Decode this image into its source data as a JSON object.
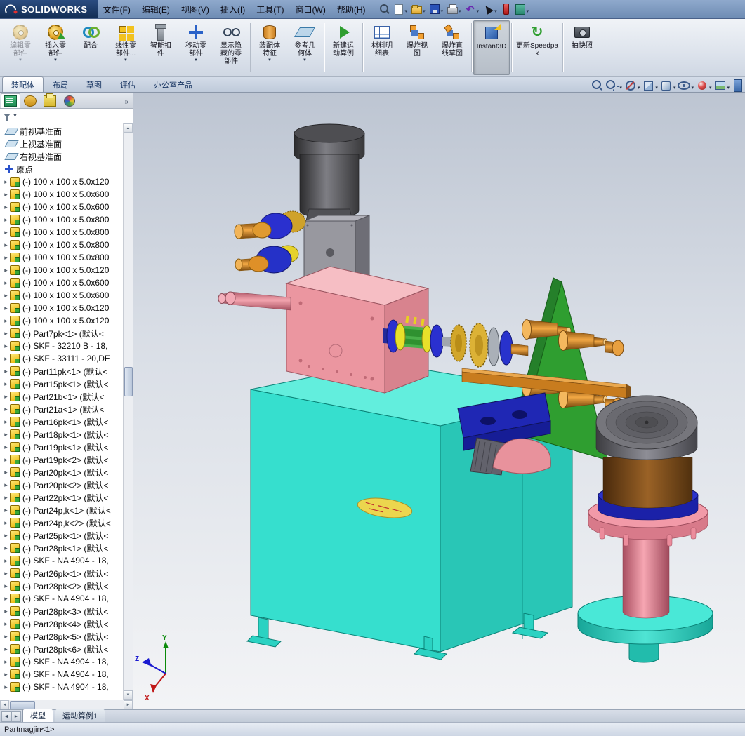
{
  "app": {
    "brand": "SOLIDWORKS",
    "menus": [
      "文件(F)",
      "编辑(E)",
      "视图(V)",
      "插入(I)",
      "工具(T)",
      "窗口(W)",
      "帮助(H)"
    ],
    "quick_access": [
      {
        "id": "search"
      },
      {
        "id": "new-document",
        "caret": true
      },
      {
        "id": "open",
        "caret": true
      },
      {
        "id": "save",
        "caret": true
      },
      {
        "id": "print",
        "caret": true
      },
      {
        "id": "undo",
        "caret": true
      },
      {
        "id": "select",
        "caret": true
      },
      {
        "id": "rebuild"
      },
      {
        "id": "options",
        "caret": true
      }
    ]
  },
  "ribbon": {
    "buttons": [
      {
        "id": "edit-component",
        "label": "编辑零部件",
        "dropdown": true,
        "disabled": true
      },
      {
        "id": "insert-component",
        "label": "插入零部件",
        "dropdown": true
      },
      {
        "id": "mate",
        "label": "配合"
      },
      {
        "id": "linear-pattern",
        "label": "线性零部件...",
        "dropdown": true
      },
      {
        "id": "smart-fasteners",
        "label": "智能扣件"
      },
      {
        "id": "move-component",
        "label": "移动零部件",
        "dropdown": true
      },
      {
        "id": "show-hidden-components",
        "label": "显示隐藏的零部件"
      },
      {
        "id": "assembly-features",
        "label": "装配体特征",
        "dropdown": true
      },
      {
        "id": "reference-geometry",
        "label": "参考几何体",
        "dropdown": true
      },
      {
        "id": "new-motion-study",
        "label": "新建运动算例"
      },
      {
        "id": "bill-of-materials",
        "label": "材料明细表"
      },
      {
        "id": "exploded-view",
        "label": "爆炸视图"
      },
      {
        "id": "explode-line-sketch",
        "label": "爆炸直线草图"
      },
      {
        "id": "instant3d",
        "label": "Instant3D",
        "active": true
      },
      {
        "id": "update-speedpak",
        "label": "更新Speedpak"
      },
      {
        "id": "take-snapshot",
        "label": "拍快照"
      }
    ]
  },
  "command_tabs": {
    "tabs": [
      {
        "id": "assembly",
        "label": "装配体",
        "active": true
      },
      {
        "id": "layout",
        "label": "布局"
      },
      {
        "id": "sketch",
        "label": "草图"
      },
      {
        "id": "evaluate",
        "label": "评估"
      },
      {
        "id": "office-products",
        "label": "办公室产品"
      }
    ]
  },
  "view_toolbar": {
    "icons": [
      {
        "id": "zoom-to-fit"
      },
      {
        "id": "zoom-to-area",
        "caret": true
      },
      {
        "id": "section-view",
        "caret": true
      },
      {
        "id": "view-orientation",
        "caret": true
      },
      {
        "id": "display-style",
        "caret": true
      },
      {
        "id": "hide-show-items",
        "caret": true
      },
      {
        "id": "edit-appearance",
        "caret": true
      },
      {
        "id": "apply-scene",
        "caret": true
      }
    ]
  },
  "panel": {
    "tabs": [
      {
        "id": "feature-manager",
        "active": true
      },
      {
        "id": "property-manager"
      },
      {
        "id": "configuration-manager"
      },
      {
        "id": "display-manager"
      }
    ],
    "overflow": "»",
    "tree": [
      {
        "icon": "plane",
        "label": "前视基准面"
      },
      {
        "icon": "plane",
        "label": "上视基准面"
      },
      {
        "icon": "plane",
        "label": "右视基准面"
      },
      {
        "icon": "origin",
        "label": "原点"
      },
      {
        "icon": "part",
        "label": "(-) 100 x 100 x 5.0x120"
      },
      {
        "icon": "part",
        "label": "(-) 100 x 100 x 5.0x600"
      },
      {
        "icon": "part",
        "label": "(-) 100 x 100 x 5.0x600"
      },
      {
        "icon": "part",
        "label": "(-) 100 x 100 x 5.0x800"
      },
      {
        "icon": "part",
        "label": "(-) 100 x 100 x 5.0x800"
      },
      {
        "icon": "part",
        "label": "(-) 100 x 100 x 5.0x800"
      },
      {
        "icon": "part",
        "label": "(-) 100 x 100 x 5.0x800"
      },
      {
        "icon": "part",
        "label": "(-) 100 x 100 x 5.0x120"
      },
      {
        "icon": "part",
        "label": "(-) 100 x 100 x 5.0x600"
      },
      {
        "icon": "part",
        "label": "(-) 100 x 100 x 5.0x600"
      },
      {
        "icon": "part",
        "label": "(-) 100 x 100 x 5.0x120"
      },
      {
        "icon": "part",
        "label": "(-) 100 x 100 x 5.0x120"
      },
      {
        "icon": "part",
        "label": "(-) Part7pk<1> (默认<"
      },
      {
        "icon": "part",
        "label": "(-) SKF - 32210 B - 18,"
      },
      {
        "icon": "part",
        "label": "(-) SKF - 33111 - 20,DE"
      },
      {
        "icon": "part",
        "label": "(-) Part11pk<1> (默认<"
      },
      {
        "icon": "part",
        "label": "(-) Part15pk<1> (默认<"
      },
      {
        "icon": "part",
        "label": "(-) Part21b<1> (默认<"
      },
      {
        "icon": "part",
        "label": "(-) Part21a<1> (默认<"
      },
      {
        "icon": "part",
        "label": "(-) Part16pk<1> (默认<"
      },
      {
        "icon": "part",
        "label": "(-) Part18pk<1> (默认<"
      },
      {
        "icon": "part",
        "label": "(-) Part19pk<1> (默认<"
      },
      {
        "icon": "part",
        "label": "(-) Part19pk<2> (默认<"
      },
      {
        "icon": "part",
        "label": "(-) Part20pk<1> (默认<"
      },
      {
        "icon": "part",
        "label": "(-) Part20pk<2> (默认<"
      },
      {
        "icon": "part",
        "label": "(-) Part22pk<1> (默认<"
      },
      {
        "icon": "part",
        "label": "(-) Part24p,k<1> (默认<"
      },
      {
        "icon": "part",
        "label": "(-) Part24p,k<2> (默认<"
      },
      {
        "icon": "part",
        "label": "(-) Part25pk<1> (默认<"
      },
      {
        "icon": "part",
        "label": "(-) Part28pk<1> (默认<"
      },
      {
        "icon": "part",
        "label": "(-) SKF - NA 4904 - 18,"
      },
      {
        "icon": "part",
        "label": "(-) Part26pk<1> (默认<"
      },
      {
        "icon": "part",
        "label": "(-) Part28pk<2> (默认<"
      },
      {
        "icon": "part",
        "label": "(-) SKF - NA 4904 - 18,"
      },
      {
        "icon": "part",
        "label": "(-) Part28pk<3> (默认<"
      },
      {
        "icon": "part",
        "label": "(-) Part28pk<4> (默认<"
      },
      {
        "icon": "part",
        "label": "(-) Part28pk<5> (默认<"
      },
      {
        "icon": "part",
        "label": "(-) Part28pk<6> (默认<"
      },
      {
        "icon": "part",
        "label": "(-) SKF - NA 4904 - 18,"
      },
      {
        "icon": "part",
        "label": "(-) SKF - NA 4904 - 18,"
      },
      {
        "icon": "part",
        "label": "(-) SKF - NA 4904 - 18,"
      }
    ]
  },
  "viewport": {
    "triad": {
      "x": "X",
      "y": "Y",
      "z": "Z"
    }
  },
  "bottom": {
    "tabs": [
      {
        "id": "model",
        "label": "模型",
        "active": true
      },
      {
        "id": "motion-study-1",
        "label": "运动算例1"
      }
    ],
    "status": "Partmagjin<1>"
  }
}
